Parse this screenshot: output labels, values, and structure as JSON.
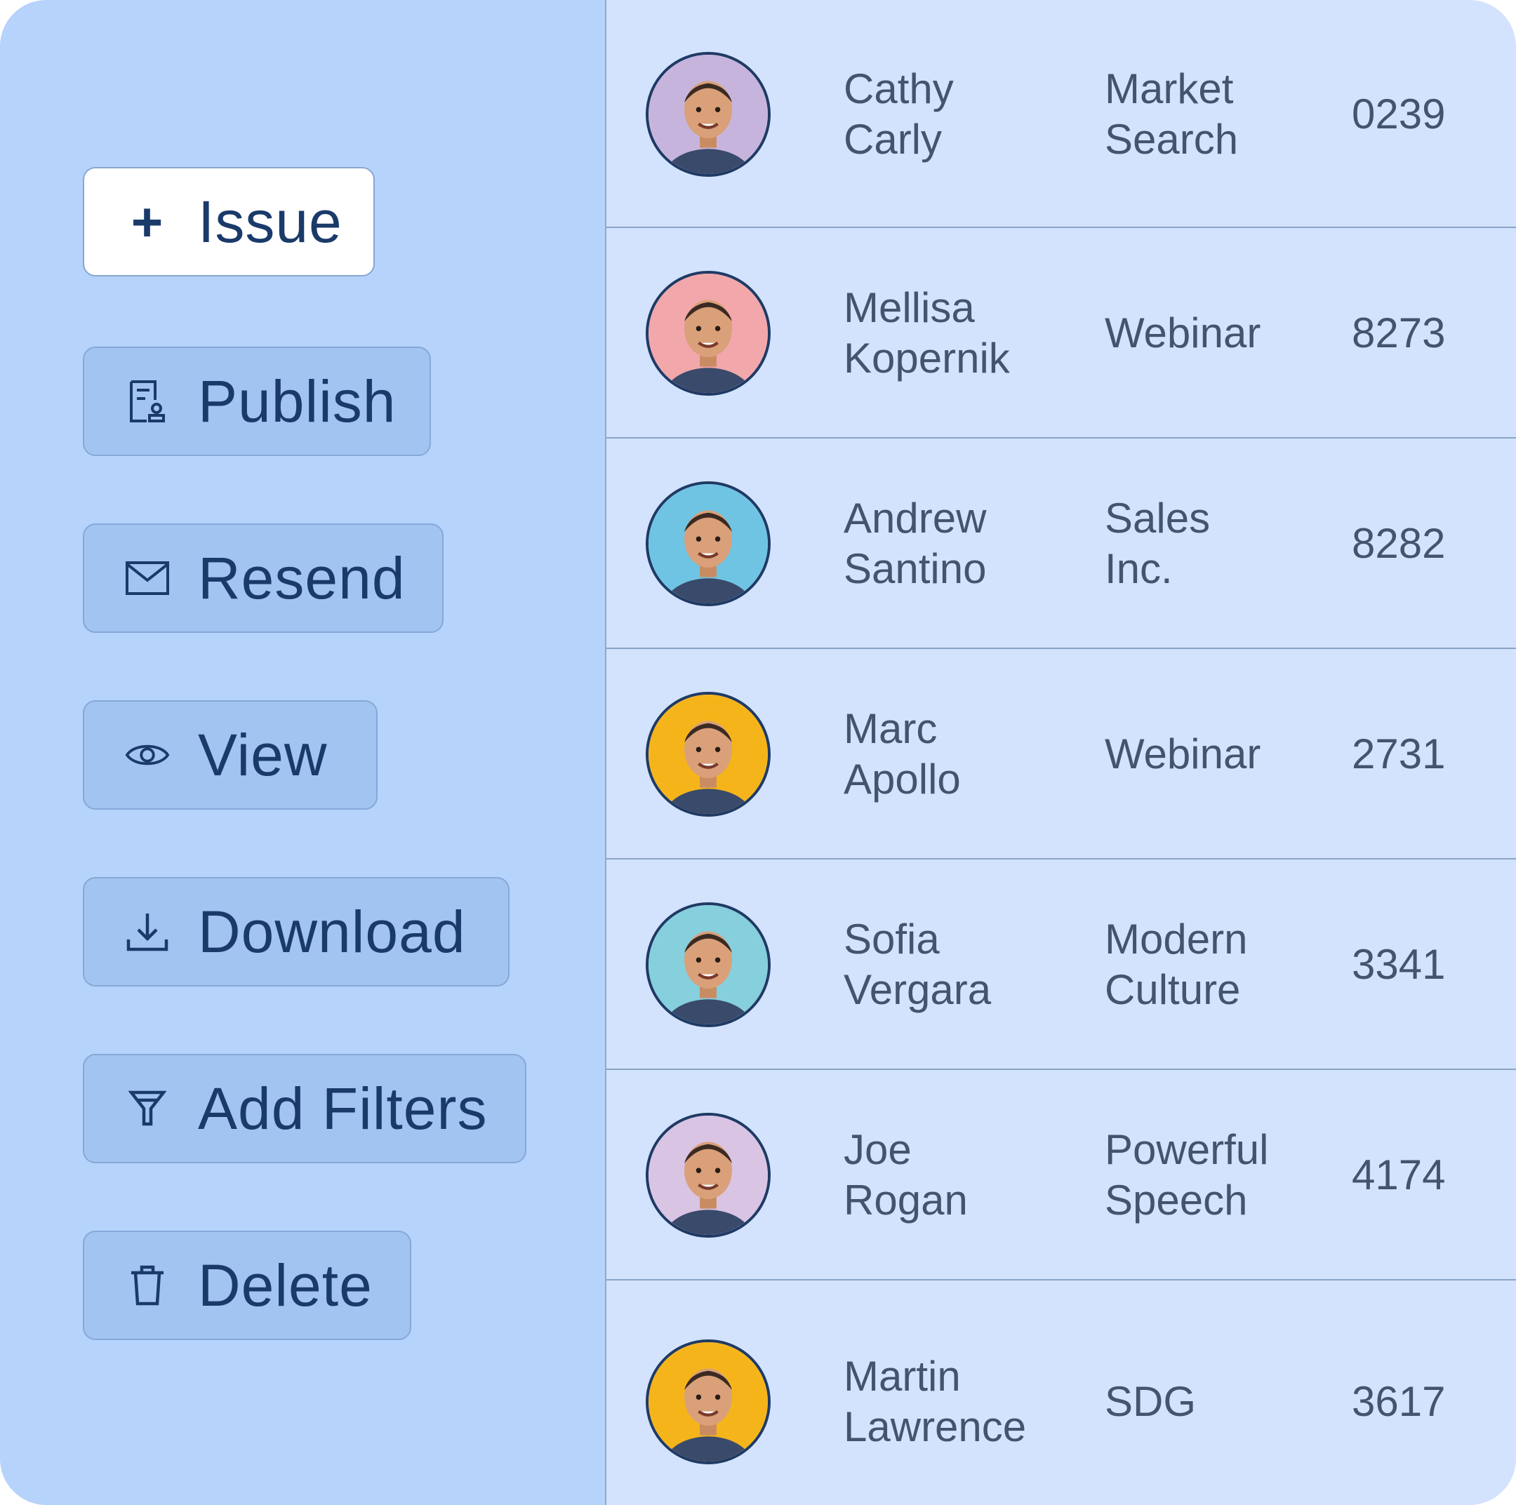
{
  "actions": {
    "issue": "Issue",
    "publish": "Publish",
    "resend": "Resend",
    "view": "View",
    "download": "Download",
    "add_filters": "Add Filters",
    "delete": "Delete"
  },
  "rows": [
    {
      "first": "Cathy",
      "last": "Carly",
      "org1": "Market",
      "org2": "Search",
      "id": "0239",
      "avatar_bg": "#c6b4dc"
    },
    {
      "first": "Mellisa",
      "last": "Kopernik",
      "org1": "Webinar",
      "org2": "",
      "id": "8273",
      "avatar_bg": "#f2a7ab"
    },
    {
      "first": "Andrew",
      "last": "Santino",
      "org1": "Sales",
      "org2": "Inc.",
      "id": "8282",
      "avatar_bg": "#6fc4e4"
    },
    {
      "first": "Marc",
      "last": "Apollo",
      "org1": "Webinar",
      "org2": "",
      "id": "2731",
      "avatar_bg": "#f5b51a"
    },
    {
      "first": "Sofia",
      "last": "Vergara",
      "org1": "Modern",
      "org2": "Culture",
      "id": "3341",
      "avatar_bg": "#86cfdc"
    },
    {
      "first": "Joe",
      "last": "Rogan",
      "org1": "Powerful",
      "org2": "Speech",
      "id": "4174",
      "avatar_bg": "#d9c4e4"
    },
    {
      "first": "Martin",
      "last": "Lawrence",
      "org1": "SDG",
      "org2": "",
      "id": "3617",
      "avatar_bg": "#f5b51a"
    }
  ],
  "colors": {
    "sidebar_bg": "#b6d3fb",
    "table_bg": "#d3e3fd",
    "button_bg": "#a2c4f0",
    "text_dark": "#1a3a6a",
    "text_cell": "#44546e"
  }
}
